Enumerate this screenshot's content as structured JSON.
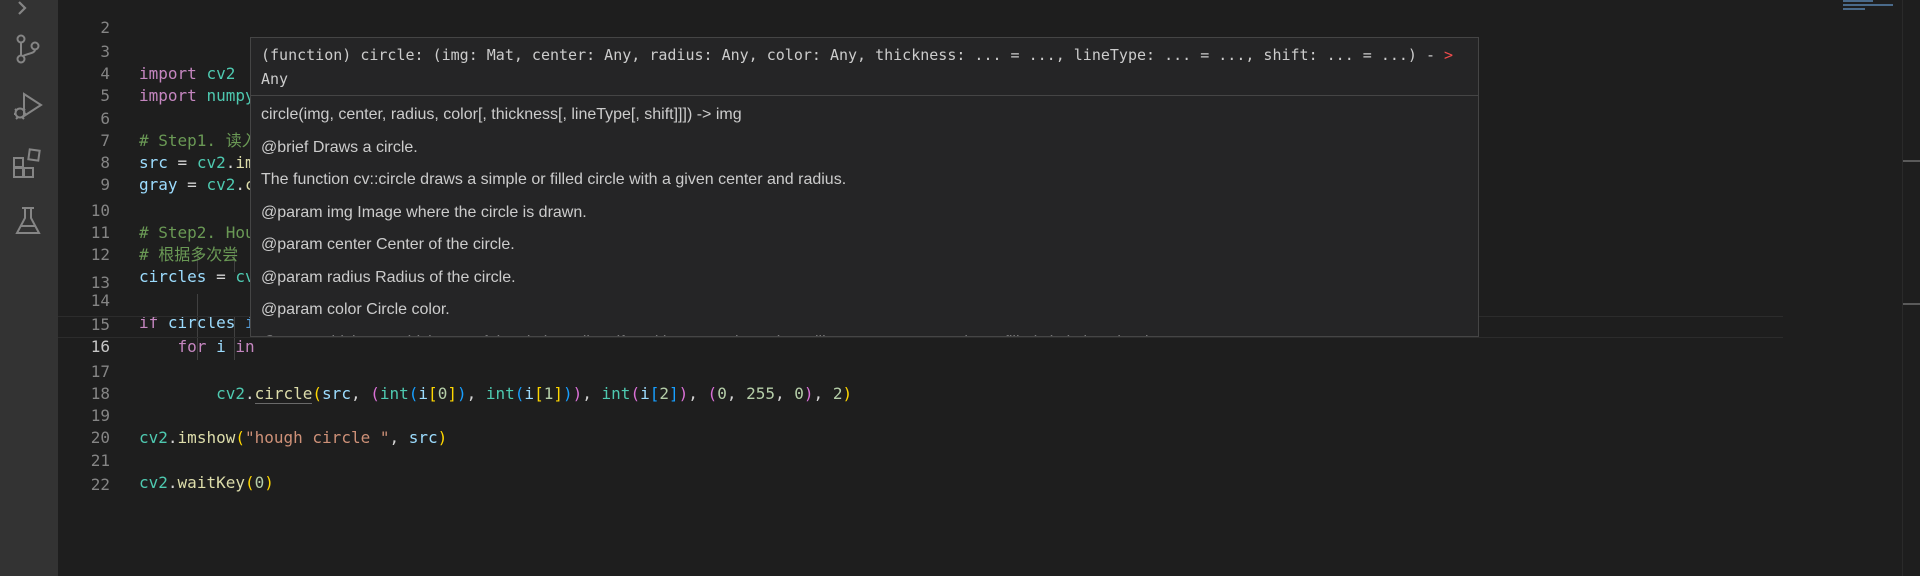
{
  "activity_bar": {
    "icons": [
      "explorer-icon",
      "source-control-icon",
      "run-debug-icon",
      "extensions-icon",
      "testing-icon"
    ]
  },
  "editor": {
    "lines": [
      {
        "n": "2",
        "code": ""
      },
      {
        "n": "3",
        "code": "import cv2"
      },
      {
        "n": "4",
        "code": "import numpy"
      },
      {
        "n": "5",
        "code": ""
      },
      {
        "n": "6",
        "code": "# Step1. 读入"
      },
      {
        "n": "7",
        "code": "src = cv2.im"
      },
      {
        "n": "8",
        "code": "gray = cv2.c"
      },
      {
        "n": "9",
        "code": ""
      },
      {
        "n": "10",
        "code": "# Step2. Hou"
      },
      {
        "n": "11",
        "code": "# 根据多次尝"
      },
      {
        "n": "12",
        "code": "circles = cv"
      },
      {
        "n": "13",
        "code": ""
      },
      {
        "n": "14",
        "code": "if circles i"
      },
      {
        "n": "15",
        "code": "    for i in"
      },
      {
        "n": "16",
        "code": ""
      },
      {
        "n": "17",
        "code": "        cv2.circle(src, (int(i[0]), int(i[1])), int(i[2]), (0, 255, 0), 2)"
      },
      {
        "n": "18",
        "code": ""
      },
      {
        "n": "19",
        "code": "cv2.imshow(\"hough circle \", src)"
      },
      {
        "n": "20",
        "code": ""
      },
      {
        "n": "21",
        "code": "cv2.waitKey(0)"
      },
      {
        "n": "22",
        "code": ""
      }
    ]
  },
  "hover": {
    "signature_main": "(function) circle: (img: Mat, center: Any, radius: Any, color: Any, thickness: ... = ..., lineType: ... = ..., shift: ... = ...) -",
    "signature_arrow": ">",
    "signature_return": " Any",
    "docs": [
      "circle(img, center, radius, color[, thickness[, lineType[, shift]]]) -> img",
      "@brief Draws a circle.",
      "The function cv::circle draws a simple or filled circle with a given center and radius.",
      "@param img Image where the circle is drawn.",
      "@param center Center of the circle.",
      "@param radius Radius of the circle.",
      "@param color Circle color.",
      "@param thickness Thickness of the circle outline, if positive. Negative values, like #FILLED, mean that a filled circle is to be drawn."
    ]
  },
  "colors": {
    "background": "#1e1e1e",
    "keyword": "#c586c0",
    "function": "#dcdcaa",
    "variable": "#9cdcfe",
    "comment": "#6a9955",
    "string": "#ce9178",
    "number": "#b5cea8"
  }
}
